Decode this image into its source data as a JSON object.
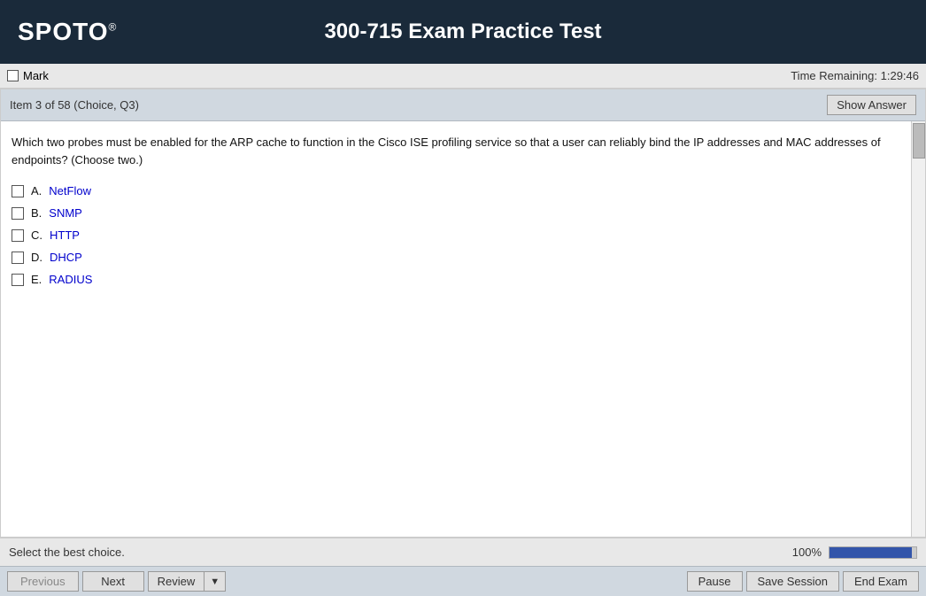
{
  "header": {
    "logo": "SPOTO",
    "logo_sup": "®",
    "title": "300-715 Exam Practice Test"
  },
  "mark_bar": {
    "mark_label": "Mark",
    "time_label": "Time Remaining:",
    "time_value": "1:29:46"
  },
  "question_header": {
    "meta": "Item 3 of 58  (Choice, Q3)",
    "show_answer_label": "Show Answer"
  },
  "question": {
    "text": "Which two probes must be enabled for the ARP cache to function in the Cisco ISE profiling service so that a user can reliably bind the IP addresses and MAC addresses of endpoints? (Choose two.)",
    "options": [
      {
        "letter": "A.",
        "text": "NetFlow"
      },
      {
        "letter": "B.",
        "text": "SNMP"
      },
      {
        "letter": "C.",
        "text": "HTTP"
      },
      {
        "letter": "D.",
        "text": "DHCP"
      },
      {
        "letter": "E.",
        "text": "RADIUS"
      }
    ]
  },
  "instruction_bar": {
    "text": "Select the best choice.",
    "progress_percent": "100%"
  },
  "footer": {
    "previous_label": "Previous",
    "next_label": "Next",
    "review_label": "Review",
    "pause_label": "Pause",
    "save_session_label": "Save Session",
    "end_exam_label": "End Exam"
  }
}
